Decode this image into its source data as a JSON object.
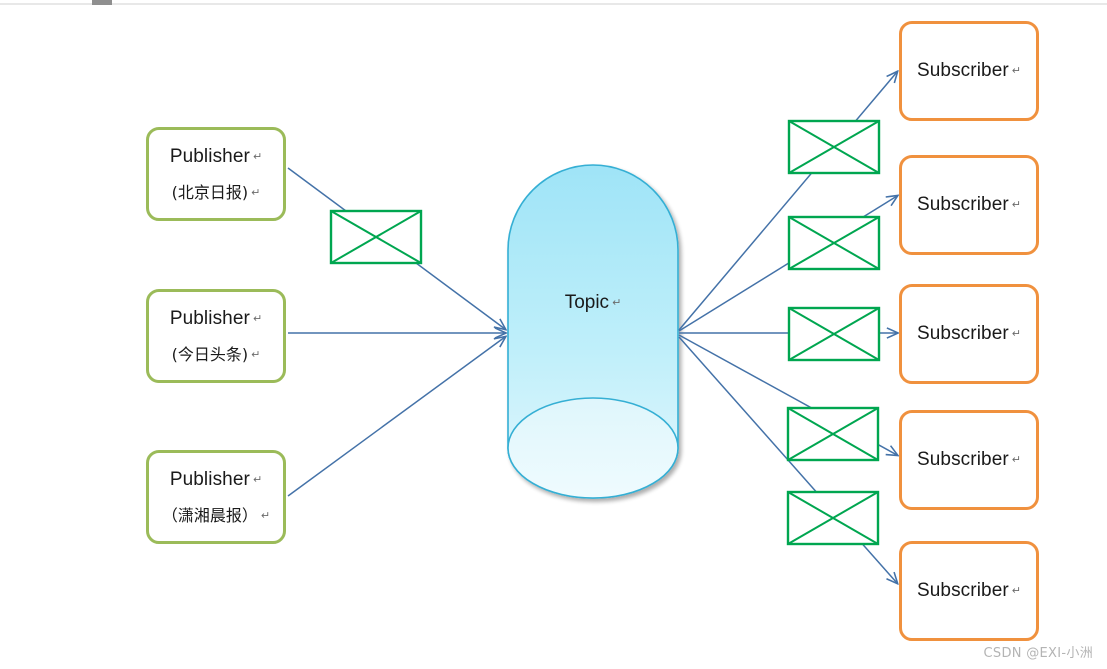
{
  "diagram": {
    "title": "Publish-Subscribe Topic Diagram",
    "colors": {
      "publisher_border": "#9BBB59",
      "subscriber_border": "#F0913E",
      "message_border": "#00A650",
      "arrow": "#4472A8",
      "cylinder_stroke": "#35AFD4",
      "cylinder_fill_top": "#9FE4F7",
      "cylinder_fill_bottom": "#E6F8FD",
      "watermark": "#b4b4b4"
    }
  },
  "scrollbar": {
    "name": "horizontal-scrollbar"
  },
  "publishers": [
    {
      "label": "Publisher",
      "pilcrow": "↵",
      "source": "(北京日报)",
      "source_pilcrow": "↵"
    },
    {
      "label": "Publisher",
      "pilcrow": "↵",
      "source": "(今日头条)",
      "source_pilcrow": "↵"
    },
    {
      "label": "Publisher",
      "pilcrow": "↵",
      "source": "（潇湘晨报）",
      "source_pilcrow": "↵"
    }
  ],
  "topic": {
    "label": "Topic",
    "pilcrow": "↵"
  },
  "subscribers": [
    {
      "label": "Subscriber",
      "pilcrow": "↵"
    },
    {
      "label": "Subscriber",
      "pilcrow": "↵"
    },
    {
      "label": "Subscriber",
      "pilcrow": "↵"
    },
    {
      "label": "Subscriber",
      "pilcrow": "↵"
    },
    {
      "label": "Subscriber",
      "pilcrow": "↵"
    }
  ],
  "messages": [
    {
      "name": "message-envelope-publisher-1"
    },
    {
      "name": "message-envelope-subscriber-1"
    },
    {
      "name": "message-envelope-subscriber-2"
    },
    {
      "name": "message-envelope-subscriber-3"
    },
    {
      "name": "message-envelope-subscriber-4"
    },
    {
      "name": "message-envelope-subscriber-5"
    }
  ],
  "watermark": {
    "text": "CSDN @EXI-小洲"
  }
}
